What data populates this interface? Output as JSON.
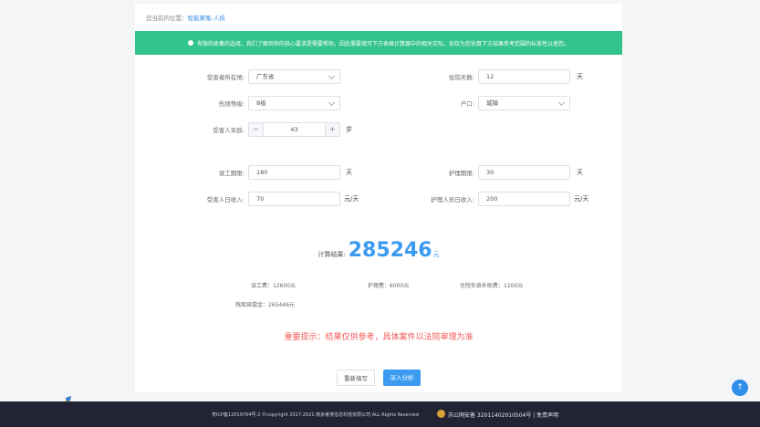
{
  "breadcrumb": {
    "prefix": "您当前的位置：",
    "link": "智能算冤-人损"
  },
  "notice": "有限的收集的选择，我们了解到你的核心要求是需要帮助，因此需要填写下方表格计算器中的相关实际，如仅为您估算下方结果参考范围的标准性以使您。",
  "form": {
    "region_label": "受害者所在地:",
    "region_value": "广东省",
    "hospital_days_label": "住院天数:",
    "hospital_days_value": "12",
    "hospital_days_unit": "天",
    "disability_label": "伤残等级:",
    "disability_value": "8级",
    "hukou_label": "户口:",
    "hukou_value": "城镇",
    "age_label": "受害人年龄:",
    "age_minus": "−",
    "age_value": "43",
    "age_plus": "+",
    "age_unit": "岁",
    "lost_work_label": "误工期限:",
    "lost_work_value": "180",
    "lost_work_unit": "天",
    "nursing_label": "护理期限:",
    "nursing_value": "30",
    "nursing_unit": "天",
    "victim_income_label": "受害人日收入:",
    "victim_income_value": "70",
    "victim_income_unit": "元/天",
    "nurse_income_label": "护理人员日收入:",
    "nurse_income_value": "200",
    "nurse_income_unit": "元/天"
  },
  "result": {
    "label": "计算结果:",
    "amount": "285246",
    "unit": "元"
  },
  "details": {
    "lost_work": "误工费：12600元",
    "nursing": "护理费：6000元",
    "meal": "住院伙食补助费：1200元",
    "disability_comp": "残疾赔偿金：265446元"
  },
  "warning": "重要提示：结果仅供参考，具体案件以法院审理为准",
  "buttons": {
    "reset": "重新填写",
    "submit": "深入分析"
  },
  "back_top": "↑",
  "footer": {
    "copy": "粤ICP备12019764号-2 ©copyright 2017-2021 南京睿搜信息科技有限公司 ALL Rights Reserved",
    "record": "苏公网安备 32011402010504号 | 免责声明"
  },
  "colors": {
    "accent": "#3a9bf0",
    "notice": "#33c38d",
    "warning": "#f25a5a",
    "footer": "#232433"
  }
}
